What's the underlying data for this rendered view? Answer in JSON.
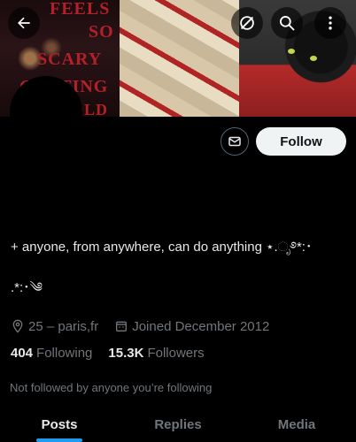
{
  "header": {
    "banner_words": [
      "FEELS",
      "SO",
      "SCARY",
      "GETTING",
      "OLD"
    ],
    "back_icon": "arrow-left-icon",
    "grok_icon": "slash-circle-icon",
    "search_icon": "search-icon",
    "more_icon": "more-vertical-icon"
  },
  "profile": {
    "bio_line1": "+ anyone, from anywhere, can do anything ⋆.ೃ࿔*:･",
    "bio_line2": ".*:･༄",
    "location": "25 – paris,fr",
    "joined": "Joined December 2012",
    "following_count": "404",
    "following_label": "Following",
    "followers_count": "15.3K",
    "followers_label": "Followers",
    "not_followed_text": "Not followed by anyone you’re following"
  },
  "actions": {
    "follow_label": "Follow",
    "message_icon": "envelope-icon"
  },
  "tabs": [
    {
      "label": "Posts",
      "active": true
    },
    {
      "label": "Replies",
      "active": false
    },
    {
      "label": "Media",
      "active": false
    }
  ],
  "colors": {
    "accent": "#1d9bf0",
    "text_primary": "#e7e9ea",
    "text_secondary": "#71767b",
    "follow_bg": "#eff3f4"
  }
}
